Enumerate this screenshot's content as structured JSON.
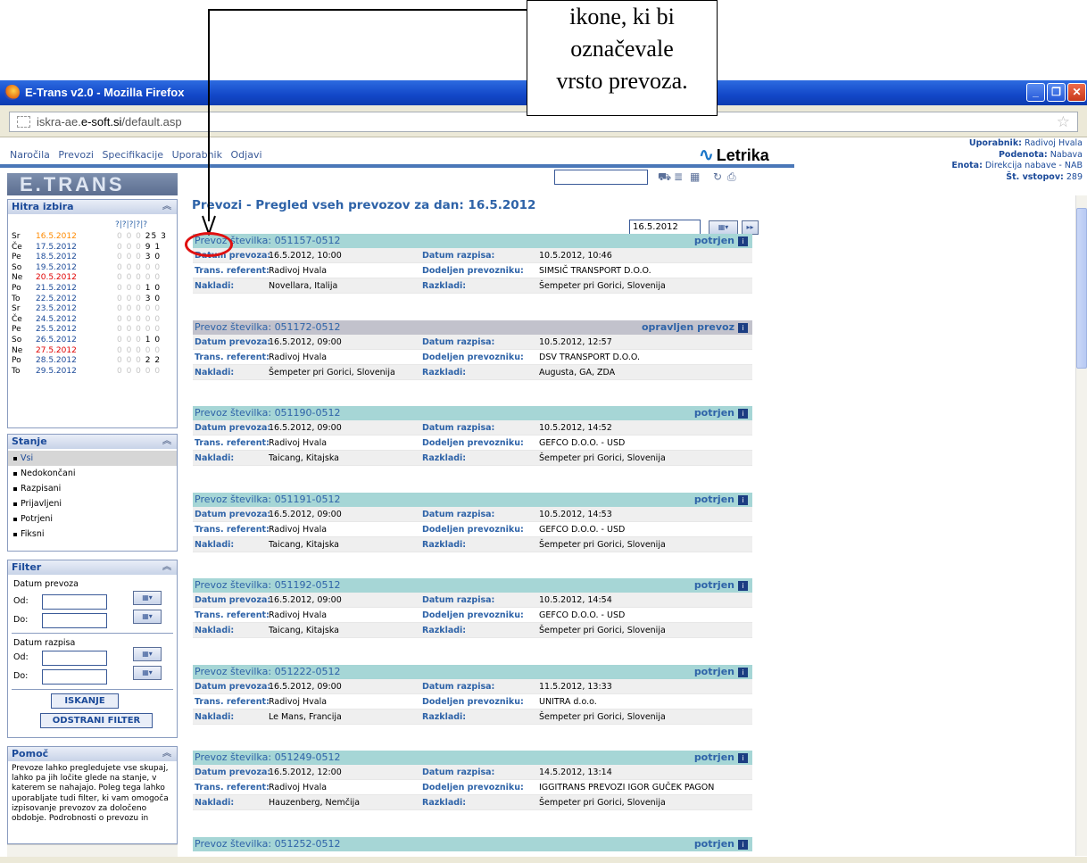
{
  "callout": {
    "lines": [
      "ikone, ki bi",
      "označevale",
      "vrsto prevoza."
    ]
  },
  "window": {
    "title": "E-Trans v2.0 - Mozilla Firefox",
    "url_prefix": "iskra-ae.",
    "url_domain": "e-soft.si",
    "url_path": "/default.asp"
  },
  "nav": {
    "items": [
      "Naročila",
      "Prevozi",
      "Specifikacije",
      "Uporabnik",
      "Odjavi"
    ]
  },
  "logo": {
    "text": "Letrika"
  },
  "user": {
    "uporabnik_label": "Uporabnik:",
    "uporabnik": "Radivoj Hvala",
    "podenota_label": "Podenota:",
    "podenota": "Nabava",
    "enota_label": "Enota:",
    "enota": "Direkcija nabave - NAB",
    "vstopov_label": "Št. vstopov:",
    "vstopov": "289"
  },
  "sidebar": {
    "brand": "E.TRANS",
    "hitra": {
      "title": "Hitra izbira",
      "rows": [
        {
          "day": "Sr",
          "date": "16.5.2012",
          "color": "orange",
          "nums": "0 0 0 ",
          "val": "25 3"
        },
        {
          "day": "Če",
          "date": "17.5.2012",
          "color": "blue",
          "nums": "0 0 0 ",
          "val": "9 1"
        },
        {
          "day": "Pe",
          "date": "18.5.2012",
          "color": "blue",
          "nums": "0 0 0 ",
          "val": "3 0"
        },
        {
          "day": "So",
          "date": "19.5.2012",
          "color": "blue",
          "nums": "0 0 0 0 0",
          "val": ""
        },
        {
          "day": "Ne",
          "date": "20.5.2012",
          "color": "red",
          "nums": "0 0 0 0 0",
          "val": ""
        },
        {
          "day": "Po",
          "date": "21.5.2012",
          "color": "blue",
          "nums": "0 0 0 ",
          "val": "1 0"
        },
        {
          "day": "To",
          "date": "22.5.2012",
          "color": "blue",
          "nums": "0 0 0 ",
          "val": "3 0"
        },
        {
          "day": "Sr",
          "date": "23.5.2012",
          "color": "blue",
          "nums": "0 0 0 0 0",
          "val": ""
        },
        {
          "day": "Če",
          "date": "24.5.2012",
          "color": "blue",
          "nums": "0 0 0 0 0",
          "val": ""
        },
        {
          "day": "Pe",
          "date": "25.5.2012",
          "color": "blue",
          "nums": "0 0 0 0 0",
          "val": ""
        },
        {
          "day": "So",
          "date": "26.5.2012",
          "color": "blue",
          "nums": "0 0 0 ",
          "val": "1 0"
        },
        {
          "day": "Ne",
          "date": "27.5.2012",
          "color": "red",
          "nums": "0 0 0 0 0",
          "val": ""
        },
        {
          "day": "Po",
          "date": "28.5.2012",
          "color": "blue",
          "nums": "0 0 0 ",
          "val": "2 2"
        },
        {
          "day": "To",
          "date": "29.5.2012",
          "color": "blue",
          "nums": "0 0 0 0 0",
          "val": ""
        }
      ]
    },
    "stanje": {
      "title": "Stanje",
      "items": [
        "Vsi",
        "Nedokončani",
        "Razpisani",
        "Prijavljeni",
        "Potrjeni",
        "Fiksni"
      ]
    },
    "filter": {
      "title": "Filter",
      "datum_prevoza": "Datum prevoza",
      "datum_razpisa": "Datum razpisa",
      "od": "Od:",
      "do": "Do:",
      "search_btn": "ISKANJE",
      "clear_btn": "ODSTRANI FILTER"
    },
    "pomoc": {
      "title": "Pomoč",
      "text": "Prevoze lahko pregledujete vse skupaj, lahko pa jih ločite glede na stanje, v katerem se nahajajo. Poleg tega lahko uporabljate tudi filter, ki vam omogoča izpisovanje prevozov za določeno obdobje. Podrobnosti o prevozu in"
    }
  },
  "main": {
    "title": "Prevozi - Pregled vseh prevozov za dan: 16.5.2012",
    "date_value": "16.5.2012",
    "labels": {
      "stevilka": "Prevoz številka:",
      "datum_prevoza": "Datum prevoza:",
      "datum_razpisa": "Datum razpisa:",
      "referent": "Trans. referent:",
      "prevoznik": "Dodeljen prevozniku:",
      "nakladi": "Nakladi:",
      "razkladi": "Razkladi:"
    },
    "cards": [
      {
        "stevilka": "051157-0512",
        "status": "potrjen",
        "grey": false,
        "datum_prevoza": "16.5.2012, 10:00",
        "datum_razpisa": "10.5.2012, 10:46",
        "referent": "Radivoj Hvala",
        "prevoznik": "SIMSIČ TRANSPORT D.O.O.",
        "nakladi": "Novellara, Italija",
        "razkladi": "Šempeter pri Gorici, Slovenija"
      },
      {
        "stevilka": "051172-0512",
        "status": "opravljen prevoz",
        "grey": true,
        "datum_prevoza": "16.5.2012, 09:00",
        "datum_razpisa": "10.5.2012, 12:57",
        "referent": "Radivoj Hvala",
        "prevoznik": "DSV TRANSPORT D.O.O.",
        "nakladi": "Šempeter pri Gorici, Slovenija",
        "razkladi": "Augusta, GA, ZDA"
      },
      {
        "stevilka": "051190-0512",
        "status": "potrjen",
        "grey": false,
        "datum_prevoza": "16.5.2012, 09:00",
        "datum_razpisa": "10.5.2012, 14:52",
        "referent": "Radivoj Hvala",
        "prevoznik": "GEFCO D.O.O. - USD",
        "nakladi": "Taicang, Kitajska",
        "razkladi": "Šempeter pri Gorici, Slovenija"
      },
      {
        "stevilka": "051191-0512",
        "status": "potrjen",
        "grey": false,
        "datum_prevoza": "16.5.2012, 09:00",
        "datum_razpisa": "10.5.2012, 14:53",
        "referent": "Radivoj Hvala",
        "prevoznik": "GEFCO D.O.O. - USD",
        "nakladi": "Taicang, Kitajska",
        "razkladi": "Šempeter pri Gorici, Slovenija"
      },
      {
        "stevilka": "051192-0512",
        "status": "potrjen",
        "grey": false,
        "datum_prevoza": "16.5.2012, 09:00",
        "datum_razpisa": "10.5.2012, 14:54",
        "referent": "Radivoj Hvala",
        "prevoznik": "GEFCO D.O.O. - USD",
        "nakladi": "Taicang, Kitajska",
        "razkladi": "Šempeter pri Gorici, Slovenija"
      },
      {
        "stevilka": "051222-0512",
        "status": "potrjen",
        "grey": false,
        "datum_prevoza": "16.5.2012, 09:00",
        "datum_razpisa": "11.5.2012, 13:33",
        "referent": "Radivoj Hvala",
        "prevoznik": "UNITRA d.o.o.",
        "nakladi": "Le Mans, Francija",
        "razkladi": "Šempeter pri Gorici, Slovenija"
      },
      {
        "stevilka": "051249-0512",
        "status": "potrjen",
        "grey": false,
        "datum_prevoza": "16.5.2012, 12:00",
        "datum_razpisa": "14.5.2012, 13:14",
        "referent": "Radivoj Hvala",
        "prevoznik": "IGGITRANS PREVOZI IGOR GUČEK PAGON",
        "nakladi": "Hauzenberg, Nemčija",
        "razkladi": "Šempeter pri Gorici, Slovenija"
      },
      {
        "stevilka": "051252-0512",
        "status": "potrjen",
        "grey": false
      }
    ]
  }
}
